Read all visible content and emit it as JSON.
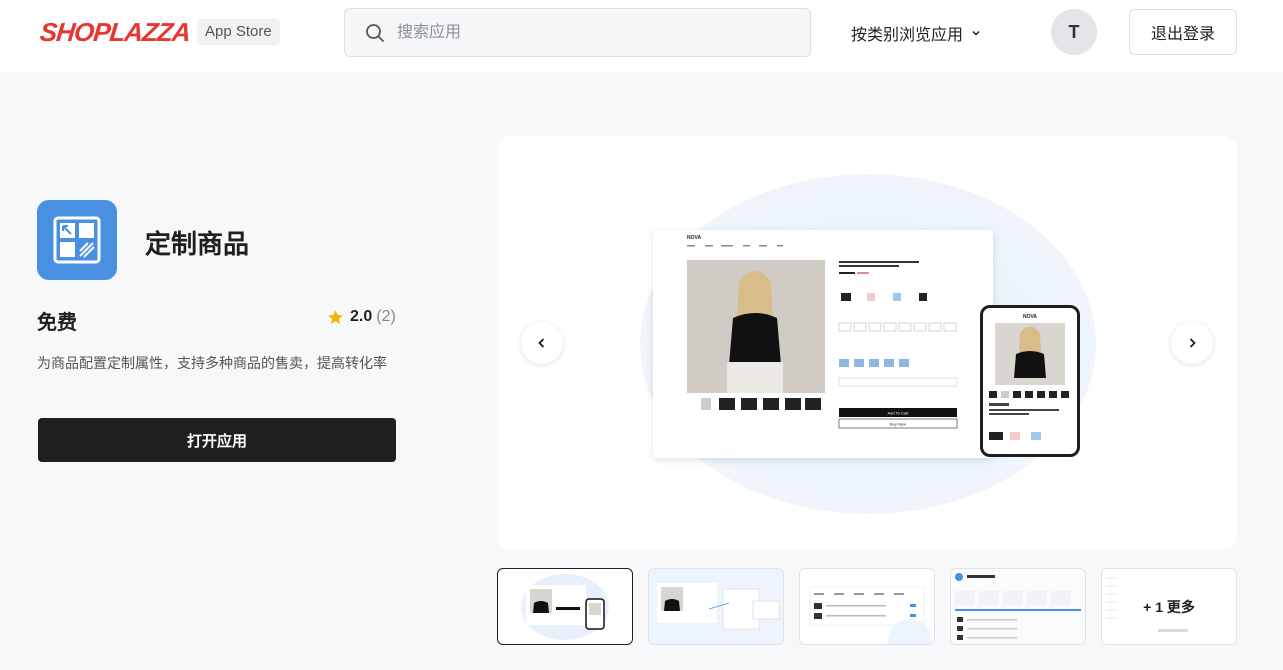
{
  "header": {
    "brand": "SHOPLAZZA",
    "store_badge": "App Store",
    "search": {
      "placeholder": "搜索应用",
      "value": ""
    },
    "browse_label": "按类别浏览应用",
    "avatar_initial": "T",
    "logout_label": "退出登录"
  },
  "app": {
    "title": "定制商品",
    "price": "免费",
    "rating": {
      "score": "2.0",
      "count": "(2)"
    },
    "description": "为商品配置定制属性，支持多种商品的售卖，提高转化率",
    "open_label": "打开应用",
    "icon_color": "#4a90e2"
  },
  "gallery": {
    "thumbnails": [
      {
        "name": "screenshot-1",
        "active": true
      },
      {
        "name": "screenshot-2",
        "active": false
      },
      {
        "name": "screenshot-3",
        "active": false
      },
      {
        "name": "screenshot-4",
        "active": false
      },
      {
        "name": "screenshot-5",
        "active": false
      }
    ],
    "more_label": "+ 1 更多",
    "mock": {
      "store_name": "NOVA",
      "add_to_cart": "Add To Cart",
      "buy_now": "Buy Now"
    }
  },
  "colors": {
    "brand": "#e8352e",
    "primary_button": "#1f1f1f",
    "accent": "#4a90e2",
    "star": "#f5b400"
  }
}
